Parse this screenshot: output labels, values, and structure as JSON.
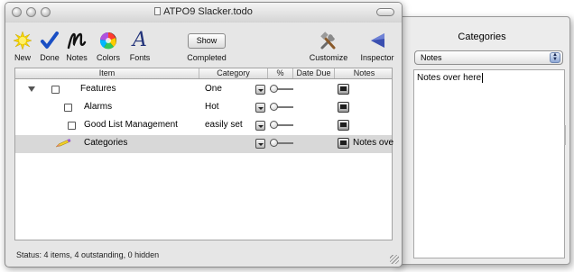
{
  "window": {
    "title": "ATPO9 Slacker.todo"
  },
  "toolbar": {
    "items": [
      {
        "label": "New",
        "icon": "sun-burst-icon"
      },
      {
        "label": "Done",
        "icon": "checkmark-icon"
      },
      {
        "label": "Notes",
        "icon": "script-n-icon"
      },
      {
        "label": "Colors",
        "icon": "color-wheel-icon"
      },
      {
        "label": "Fonts",
        "icon": "italic-a-icon"
      },
      {
        "label": "Completed",
        "icon": "show-button"
      },
      {
        "label": "Customize",
        "icon": "tools-icon"
      },
      {
        "label": "Inspector",
        "icon": "left-arrow-icon"
      }
    ],
    "show_label": "Show"
  },
  "table": {
    "columns": [
      "Item",
      "Category",
      "%",
      "Date Due",
      "Notes"
    ],
    "rows": [
      {
        "item": "Features",
        "category": "One",
        "notes": "",
        "level": 0,
        "expanded": true,
        "selected": false
      },
      {
        "item": "Alarms",
        "category": "Hot",
        "notes": "",
        "level": 1,
        "selected": false
      },
      {
        "item": "Good List Management",
        "category": "easily set",
        "notes": "",
        "level": 1,
        "selected": false
      },
      {
        "item": "Categories",
        "category": "",
        "notes": "Notes ove",
        "level": 1,
        "selected": true
      }
    ]
  },
  "status": {
    "text": "Status: 4 items, 4 outstanding, 0 hidden"
  },
  "inspector": {
    "title": "Categories",
    "select_value": "Notes",
    "notes_text": "Notes over here"
  },
  "colors": {
    "done_check": "#1a4fc4",
    "inspector_arrow": "#3a4fb0",
    "selected_row": "#d8d8d8"
  }
}
